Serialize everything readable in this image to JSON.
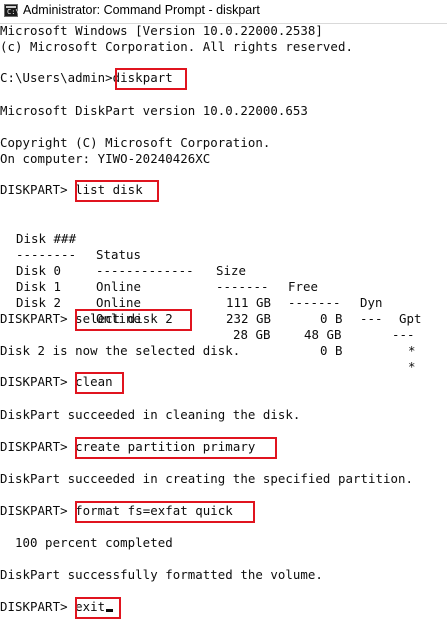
{
  "window": {
    "title": "Administrator: Command Prompt - diskpart",
    "icon": "cmd-icon"
  },
  "console": {
    "banner_1": "Microsoft Windows [Version 10.0.22000.2538]",
    "banner_2": "(c) Microsoft Corporation. All rights reserved.",
    "prompt_path": "C:\\Users\\admin>",
    "cmd_diskpart": "diskpart",
    "dp_version": "Microsoft DiskPart version 10.0.22000.653",
    "copyright": "Copyright (C) Microsoft Corporation.",
    "computer": "On computer: YIWO-20240426XC",
    "dp_prompt": "DISKPART>",
    "cmd_list_disk": "list disk",
    "table": {
      "headers": [
        "Disk ###",
        "Status",
        "Size",
        "Free",
        "Dyn",
        "Gpt"
      ],
      "separators": [
        "--------",
        "-------------",
        "-------",
        "-------",
        "---",
        "---"
      ],
      "rows": [
        [
          "Disk 0",
          "Online",
          "111 GB",
          "0 B",
          "",
          ""
        ],
        [
          "Disk 1",
          "Online",
          "232 GB",
          "48 GB",
          "",
          "*"
        ],
        [
          "Disk 2",
          "Online",
          "28 GB",
          "0 B",
          "",
          "*"
        ]
      ]
    },
    "cmd_select": "select disk 2",
    "msg_selected": "Disk 2 is now the selected disk.",
    "cmd_clean": "clean",
    "msg_clean": "DiskPart succeeded in cleaning the disk.",
    "cmd_create": "create partition primary",
    "msg_create": "DiskPart succeeded in creating the specified partition.",
    "cmd_format": "format fs=exfat quick",
    "progress_text": "  100 percent completed",
    "msg_format": "DiskPart successfully formatted the volume.",
    "cmd_exit": "exit"
  },
  "colors": {
    "highlight": "#e0141f",
    "text": "#0c0c0c",
    "background": "#ffffff"
  }
}
